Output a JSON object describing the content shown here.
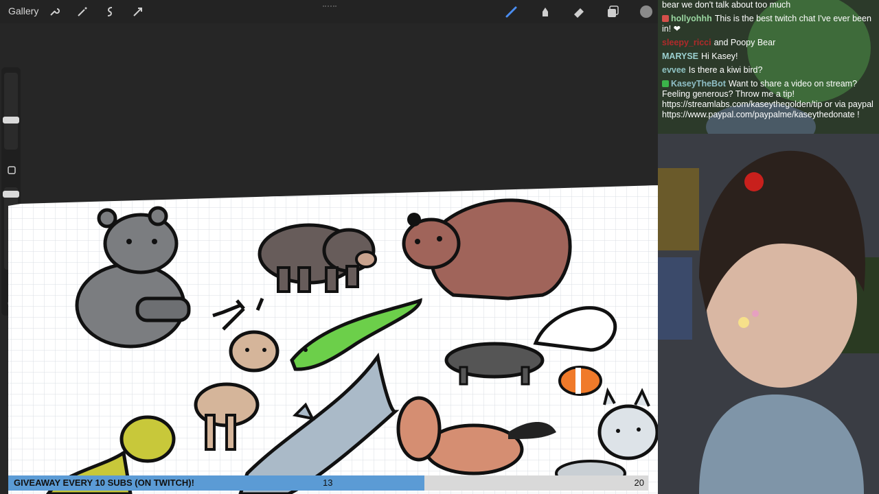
{
  "app": {
    "gallery_label": "Gallery",
    "tools_left": [
      "wrench-icon",
      "magic-wand-icon",
      "selection-icon",
      "transform-icon"
    ],
    "tools_right": [
      "brush-icon",
      "smudge-icon",
      "eraser-icon",
      "layers-icon",
      "color-icon"
    ],
    "accent": "#4a8df0"
  },
  "chat": {
    "messages": [
      {
        "user": "",
        "text": "bear we don't talk about too much",
        "color": "#ffffff"
      },
      {
        "user": "hollyohhh",
        "text": "This is the best twitch chat I've ever been in! ❤",
        "color": "#9ad6a0",
        "badge": "#d4504a"
      },
      {
        "user": "sleepy_ricci",
        "text": "and Poopy Bear",
        "color": "#b02a2a"
      },
      {
        "user": "MARYSE",
        "text": "Hi Kasey!",
        "color": "#9bd0d0"
      },
      {
        "user": "evvee",
        "text": "Is there a kiwi bird?",
        "color": "#8ec2c2"
      },
      {
        "user": "KaseyTheBot",
        "text": "Want to share a video on stream? Feeling generous? Throw me a tip! https://streamlabs.com/kaseythegolden/tip or via paypal https://www.paypal.com/paypalme/kaseythedonate !",
        "color": "#8fbfc6",
        "badge": "#3bb54a"
      }
    ]
  },
  "giveaway": {
    "label": "GIVEAWAY EVERY 10 SUBS (ON TWITCH)!",
    "current": "13",
    "goal": "20",
    "progress": 0.65,
    "fill_color": "#5b9bd5",
    "bg_color": "#d9d9d9"
  }
}
